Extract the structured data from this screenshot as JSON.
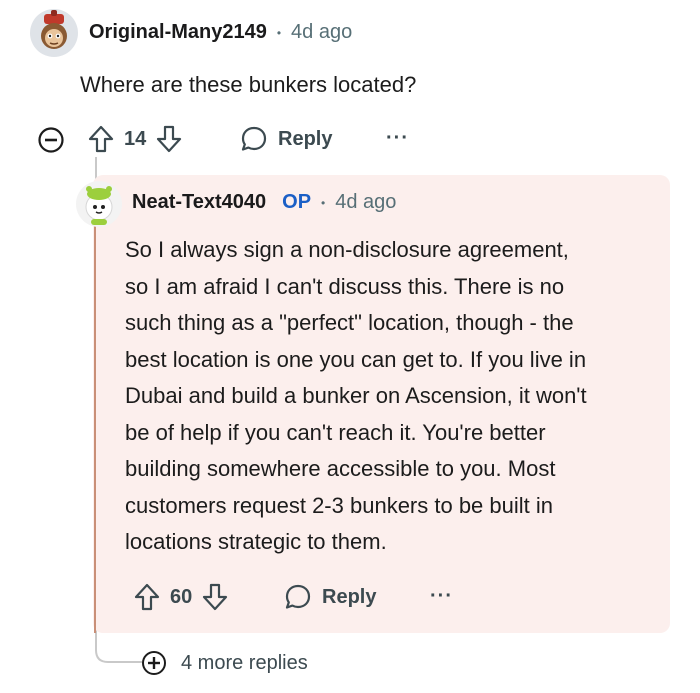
{
  "parent": {
    "username": "Original-Many2149",
    "separator": "•",
    "time": "4d ago",
    "text": "Where are these bunkers located?",
    "score": "14",
    "reply_label": "Reply",
    "more_label": "···"
  },
  "child": {
    "username": "Neat-Text4040",
    "op_badge": "OP",
    "separator": "•",
    "time": "4d ago",
    "lines": [
      "So I always sign a non-disclosure agreement,",
      "so I am afraid I can't discuss this. There is no",
      "such thing as a \"perfect\" location, though - the",
      "best location is one you can get to. If you live in",
      "Dubai and build a bunker on Ascension, it won't",
      "be of help if you can't reach it. You're better",
      "building somewhere accessible to you. Most",
      "customers request 2-3 bunkers to be built in",
      "locations strategic to them."
    ],
    "score": "60",
    "reply_label": "Reply",
    "more_label": "···"
  },
  "more_replies": "4 more replies",
  "colors": {
    "card_bg": "#fcefed",
    "op_blue": "#1b5fc6",
    "thread_line": "#c9c9c9",
    "text": "#1c1c1c",
    "meta": "#576f76"
  }
}
